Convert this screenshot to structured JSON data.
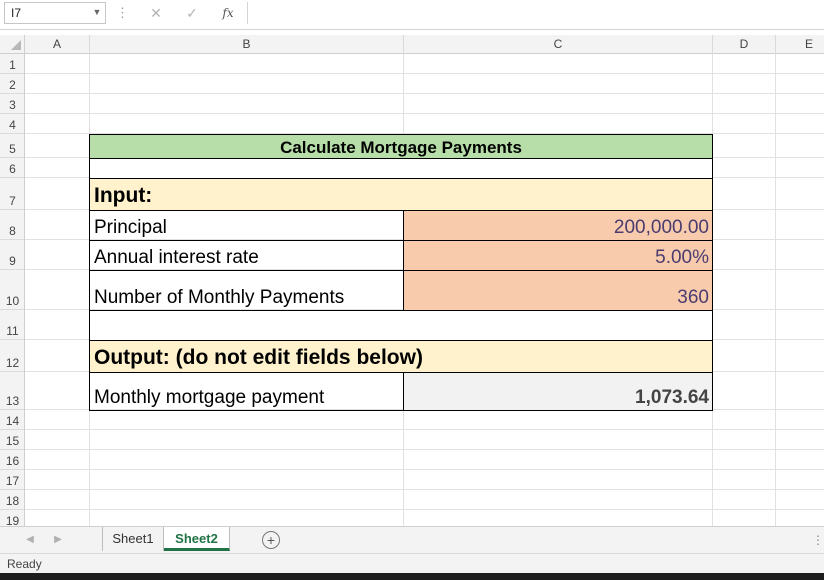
{
  "formula_bar": {
    "name_box": "I7",
    "cancel_icon": "✕",
    "enter_icon": "✓",
    "fx_label": "fx",
    "formula": ""
  },
  "columns": [
    "A",
    "B",
    "C",
    "D",
    "E"
  ],
  "rows": [
    "1",
    "2",
    "3",
    "4",
    "5",
    "6",
    "7",
    "8",
    "9",
    "10",
    "11",
    "12",
    "13",
    "14",
    "15",
    "16",
    "17",
    "18",
    "19"
  ],
  "sheet": {
    "title": "Calculate Mortgage Payments",
    "input_header": "Input:",
    "principal_label": "Principal",
    "principal_value": "200,000.00",
    "rate_label": "Annual interest rate",
    "rate_value": "5.00%",
    "payments_label": "Number of Monthly Payments",
    "payments_value": "360",
    "output_header": "Output: (do not edit fields below)",
    "payment_label": "Monthly mortgage payment",
    "payment_value": "1,073.64"
  },
  "tabs": [
    "Sheet1",
    "Sheet2"
  ],
  "active_tab": "Sheet2",
  "status": "Ready",
  "colors": {
    "title_fill": "#b7dea8",
    "section_fill": "#fff2cc",
    "input_fill": "#f8cbad",
    "output_fill": "#f2f2f2",
    "active_tab": "#217346"
  }
}
